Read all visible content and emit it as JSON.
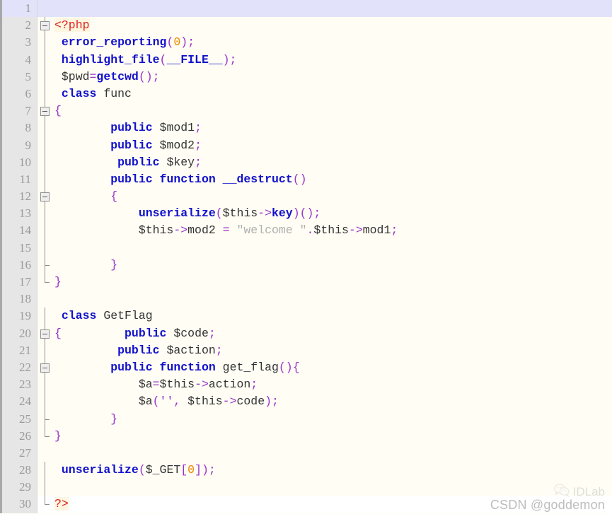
{
  "editor": {
    "language": "php",
    "total_lines": 30,
    "current_line": 1,
    "colors": {
      "background": "#fffdf4",
      "gutter_background": "#e6e6e6",
      "gutter_text": "#9a9a9a",
      "current_line_highlight": "#e2e2fa",
      "keyword": "#1111cc",
      "punctuation": "#9933cc",
      "number": "#ee8800",
      "string": "#b0b0b0",
      "php_tag": "#dd2222",
      "plain_text": "#333333"
    }
  },
  "lines": [
    {
      "num": "1",
      "current": true,
      "fold": "none",
      "tokens": []
    },
    {
      "num": "2",
      "current": false,
      "fold": "box-down",
      "tokens": [
        {
          "t": "t-tag",
          "v": "<?php"
        }
      ]
    },
    {
      "num": "3",
      "current": false,
      "fold": "line",
      "tokens": [
        {
          "t": "t-plain",
          "v": " "
        },
        {
          "t": "t-fn",
          "v": "error_reporting"
        },
        {
          "t": "t-punc",
          "v": "("
        },
        {
          "t": "t-num",
          "v": "0"
        },
        {
          "t": "t-punc",
          "v": ");"
        }
      ]
    },
    {
      "num": "4",
      "current": false,
      "fold": "line",
      "tokens": [
        {
          "t": "t-plain",
          "v": " "
        },
        {
          "t": "t-fn",
          "v": "highlight_file"
        },
        {
          "t": "t-punc",
          "v": "("
        },
        {
          "t": "t-const",
          "v": "__FILE__"
        },
        {
          "t": "t-punc",
          "v": ");"
        }
      ]
    },
    {
      "num": "5",
      "current": false,
      "fold": "line",
      "tokens": [
        {
          "t": "t-plain",
          "v": " "
        },
        {
          "t": "t-var",
          "v": "$pwd"
        },
        {
          "t": "t-op",
          "v": "="
        },
        {
          "t": "t-fn",
          "v": "getcwd"
        },
        {
          "t": "t-punc",
          "v": "();"
        }
      ]
    },
    {
      "num": "6",
      "current": false,
      "fold": "line",
      "tokens": [
        {
          "t": "t-plain",
          "v": " "
        },
        {
          "t": "t-kw",
          "v": "class"
        },
        {
          "t": "t-plain",
          "v": " func"
        }
      ]
    },
    {
      "num": "7",
      "current": false,
      "fold": "box-down",
      "tokens": [
        {
          "t": "t-punc",
          "v": "{"
        }
      ]
    },
    {
      "num": "8",
      "current": false,
      "fold": "line",
      "tokens": [
        {
          "t": "t-plain",
          "v": "        "
        },
        {
          "t": "t-kw",
          "v": "public"
        },
        {
          "t": "t-plain",
          "v": " "
        },
        {
          "t": "t-var",
          "v": "$mod1"
        },
        {
          "t": "t-punc",
          "v": ";"
        }
      ]
    },
    {
      "num": "9",
      "current": false,
      "fold": "line",
      "tokens": [
        {
          "t": "t-plain",
          "v": "        "
        },
        {
          "t": "t-kw",
          "v": "public"
        },
        {
          "t": "t-plain",
          "v": " "
        },
        {
          "t": "t-var",
          "v": "$mod2"
        },
        {
          "t": "t-punc",
          "v": ";"
        }
      ]
    },
    {
      "num": "10",
      "current": false,
      "fold": "line",
      "tokens": [
        {
          "t": "t-plain",
          "v": "         "
        },
        {
          "t": "t-kw",
          "v": "public"
        },
        {
          "t": "t-plain",
          "v": " "
        },
        {
          "t": "t-var",
          "v": "$key"
        },
        {
          "t": "t-punc",
          "v": ";"
        }
      ]
    },
    {
      "num": "11",
      "current": false,
      "fold": "line",
      "tokens": [
        {
          "t": "t-plain",
          "v": "        "
        },
        {
          "t": "t-kw",
          "v": "public"
        },
        {
          "t": "t-plain",
          "v": " "
        },
        {
          "t": "t-kw",
          "v": "function"
        },
        {
          "t": "t-plain",
          "v": " "
        },
        {
          "t": "t-fn",
          "v": "__destruct"
        },
        {
          "t": "t-punc",
          "v": "()"
        }
      ]
    },
    {
      "num": "12",
      "current": false,
      "fold": "box-down",
      "tokens": [
        {
          "t": "t-plain",
          "v": "        "
        },
        {
          "t": "t-punc",
          "v": "{"
        }
      ]
    },
    {
      "num": "13",
      "current": false,
      "fold": "line",
      "tokens": [
        {
          "t": "t-plain",
          "v": "            "
        },
        {
          "t": "t-fn",
          "v": "unserialize"
        },
        {
          "t": "t-punc",
          "v": "("
        },
        {
          "t": "t-var",
          "v": "$this"
        },
        {
          "t": "t-op",
          "v": "->"
        },
        {
          "t": "t-kw",
          "v": "key"
        },
        {
          "t": "t-punc",
          "v": ")();"
        }
      ]
    },
    {
      "num": "14",
      "current": false,
      "fold": "line",
      "tokens": [
        {
          "t": "t-plain",
          "v": "            "
        },
        {
          "t": "t-var",
          "v": "$this"
        },
        {
          "t": "t-op",
          "v": "->"
        },
        {
          "t": "t-plain",
          "v": "mod2 "
        },
        {
          "t": "t-op",
          "v": "="
        },
        {
          "t": "t-plain",
          "v": " "
        },
        {
          "t": "t-str",
          "v": "\"welcome \""
        },
        {
          "t": "t-op",
          "v": "."
        },
        {
          "t": "t-var",
          "v": "$this"
        },
        {
          "t": "t-op",
          "v": "->"
        },
        {
          "t": "t-plain",
          "v": "mod1"
        },
        {
          "t": "t-punc",
          "v": ";"
        }
      ]
    },
    {
      "num": "15",
      "current": false,
      "fold": "line",
      "tokens": []
    },
    {
      "num": "16",
      "current": false,
      "fold": "tick-up",
      "tokens": [
        {
          "t": "t-plain",
          "v": "        "
        },
        {
          "t": "t-punc",
          "v": "}"
        }
      ]
    },
    {
      "num": "17",
      "current": false,
      "fold": "tick-end",
      "tokens": [
        {
          "t": "t-punc",
          "v": "}"
        }
      ]
    },
    {
      "num": "18",
      "current": false,
      "fold": "none",
      "tokens": []
    },
    {
      "num": "19",
      "current": false,
      "fold": "line",
      "tokens": [
        {
          "t": "t-plain",
          "v": " "
        },
        {
          "t": "t-kw",
          "v": "class"
        },
        {
          "t": "t-plain",
          "v": " GetFlag"
        }
      ]
    },
    {
      "num": "20",
      "current": false,
      "fold": "box-down",
      "tokens": [
        {
          "t": "t-punc",
          "v": "{"
        },
        {
          "t": "t-plain",
          "v": "         "
        },
        {
          "t": "t-kw",
          "v": "public"
        },
        {
          "t": "t-plain",
          "v": " "
        },
        {
          "t": "t-var",
          "v": "$code"
        },
        {
          "t": "t-punc",
          "v": ";"
        }
      ]
    },
    {
      "num": "21",
      "current": false,
      "fold": "line",
      "tokens": [
        {
          "t": "t-plain",
          "v": "         "
        },
        {
          "t": "t-kw",
          "v": "public"
        },
        {
          "t": "t-plain",
          "v": " "
        },
        {
          "t": "t-var",
          "v": "$action"
        },
        {
          "t": "t-punc",
          "v": ";"
        }
      ]
    },
    {
      "num": "22",
      "current": false,
      "fold": "box-down",
      "tokens": [
        {
          "t": "t-plain",
          "v": "        "
        },
        {
          "t": "t-kw",
          "v": "public"
        },
        {
          "t": "t-plain",
          "v": " "
        },
        {
          "t": "t-kw",
          "v": "function"
        },
        {
          "t": "t-plain",
          "v": " get_flag"
        },
        {
          "t": "t-punc",
          "v": "(){"
        }
      ]
    },
    {
      "num": "23",
      "current": false,
      "fold": "line",
      "tokens": [
        {
          "t": "t-plain",
          "v": "            "
        },
        {
          "t": "t-var",
          "v": "$a"
        },
        {
          "t": "t-op",
          "v": "="
        },
        {
          "t": "t-var",
          "v": "$this"
        },
        {
          "t": "t-op",
          "v": "->"
        },
        {
          "t": "t-plain",
          "v": "action"
        },
        {
          "t": "t-punc",
          "v": ";"
        }
      ]
    },
    {
      "num": "24",
      "current": false,
      "fold": "line",
      "tokens": [
        {
          "t": "t-plain",
          "v": "            "
        },
        {
          "t": "t-var",
          "v": "$a"
        },
        {
          "t": "t-punc",
          "v": "('', "
        },
        {
          "t": "t-var",
          "v": "$this"
        },
        {
          "t": "t-op",
          "v": "->"
        },
        {
          "t": "t-plain",
          "v": "code"
        },
        {
          "t": "t-punc",
          "v": ");"
        }
      ]
    },
    {
      "num": "25",
      "current": false,
      "fold": "tick-up",
      "tokens": [
        {
          "t": "t-plain",
          "v": "        "
        },
        {
          "t": "t-punc",
          "v": "}"
        }
      ]
    },
    {
      "num": "26",
      "current": false,
      "fold": "tick-end",
      "tokens": [
        {
          "t": "t-punc",
          "v": "}"
        }
      ]
    },
    {
      "num": "27",
      "current": false,
      "fold": "none",
      "tokens": []
    },
    {
      "num": "28",
      "current": false,
      "fold": "line",
      "tokens": [
        {
          "t": "t-plain",
          "v": " "
        },
        {
          "t": "t-fn",
          "v": "unserialize"
        },
        {
          "t": "t-punc",
          "v": "("
        },
        {
          "t": "t-var",
          "v": "$_GET"
        },
        {
          "t": "t-punc",
          "v": "["
        },
        {
          "t": "t-num",
          "v": "0"
        },
        {
          "t": "t-punc",
          "v": "]);"
        }
      ]
    },
    {
      "num": "29",
      "current": false,
      "fold": "line",
      "tokens": []
    },
    {
      "num": "30",
      "current": false,
      "fold": "tick-end",
      "tokens": [
        {
          "t": "t-tag",
          "v": "?>"
        }
      ],
      "tail": true
    }
  ],
  "watermark": {
    "icon": "wechat-icon",
    "brand": "IDLab",
    "credit": "CSDN @goddemon"
  }
}
